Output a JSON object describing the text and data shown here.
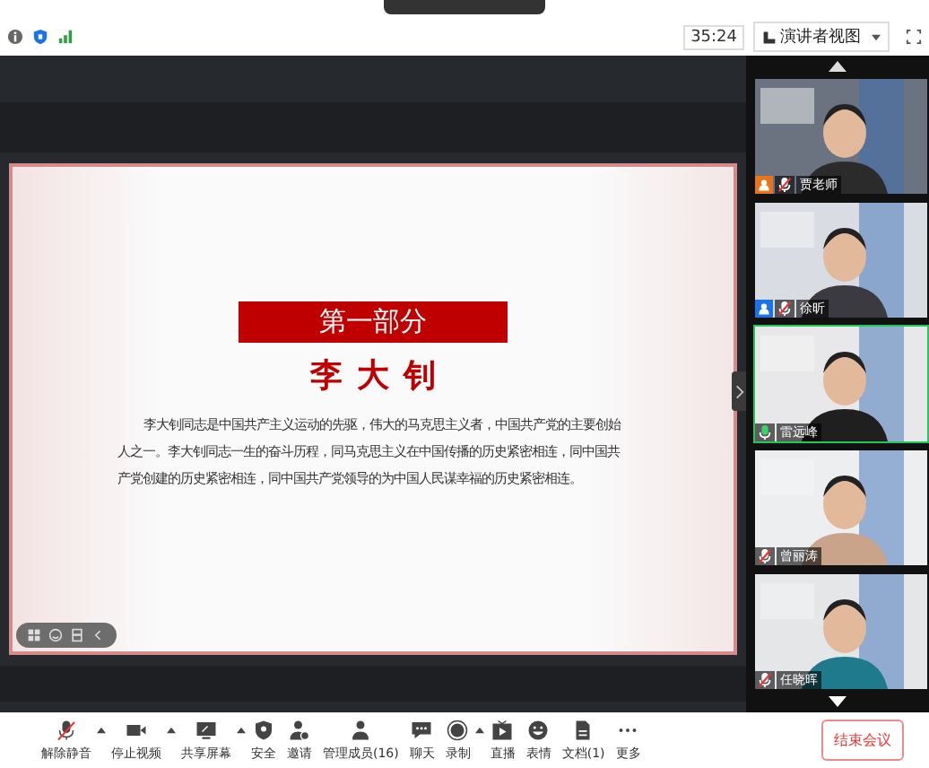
{
  "status_bar": {
    "timer": "35:24",
    "view_button": "演讲者视图"
  },
  "slide": {
    "section_title": "第一部分",
    "heading": "李大钊",
    "body": "李大钊同志是中国共产主义运动的先驱，伟大的马克思主义者，中国共产党的主要创始人之一。李大钊同志一生的奋斗历程，同马克思主义在中国传播的历史紧密相连，同中国共产党创建的历史紧密相连，同中国共产党领导的为中国人民谋幸福的历史紧密相连。"
  },
  "participants": [
    {
      "name": "贾老师",
      "host": true,
      "cohost": false,
      "speaking": false
    },
    {
      "name": "徐昕",
      "host": false,
      "cohost": true,
      "speaking": false
    },
    {
      "name": "雷远峰",
      "host": false,
      "cohost": false,
      "speaking": true
    },
    {
      "name": "曾丽涛",
      "host": false,
      "cohost": false,
      "speaking": false
    },
    {
      "name": "任晓晖",
      "host": false,
      "cohost": false,
      "speaking": false
    }
  ],
  "toolbar": [
    {
      "label": "解除静音",
      "kind": "mic",
      "caret": true
    },
    {
      "label": "停止视频",
      "kind": "video",
      "caret": true
    },
    {
      "label": "共享屏幕",
      "kind": "share",
      "caret": true
    },
    {
      "label": "安全",
      "kind": "shield",
      "caret": false
    },
    {
      "label": "邀请",
      "kind": "invite",
      "caret": false
    },
    {
      "label": "管理成员(16)",
      "kind": "person",
      "caret": false
    },
    {
      "label": "聊天",
      "kind": "chat",
      "caret": false
    },
    {
      "label": "录制",
      "kind": "record",
      "caret": true
    },
    {
      "label": "直播",
      "kind": "live",
      "caret": false
    },
    {
      "label": "表情",
      "kind": "smile",
      "caret": false
    },
    {
      "label": "文档(1)",
      "kind": "doc",
      "caret": false
    },
    {
      "label": "更多",
      "kind": "more",
      "caret": false
    }
  ],
  "end_button": "结束会议"
}
